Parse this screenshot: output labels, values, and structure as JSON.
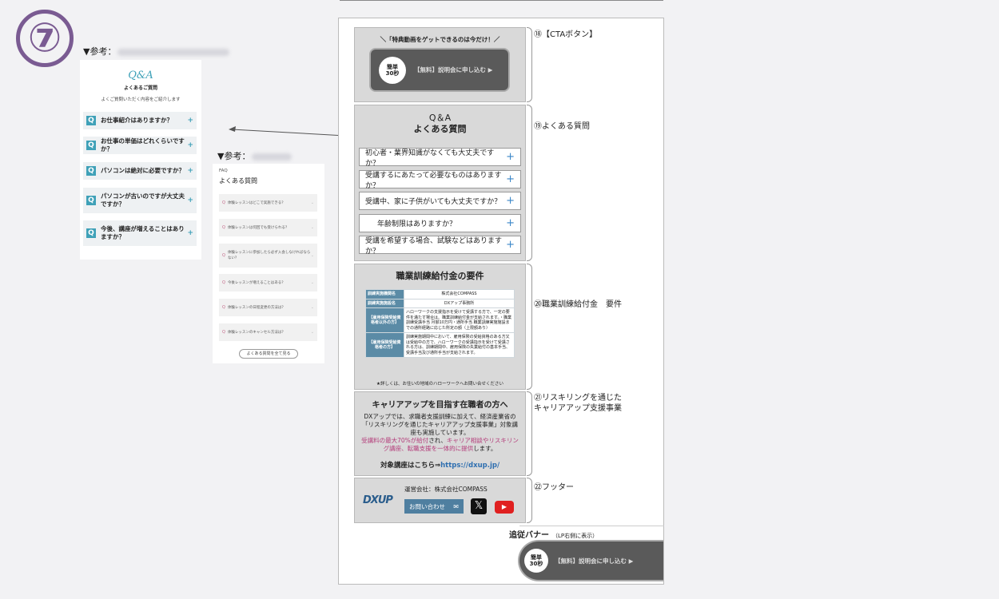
{
  "step_number": "⑦",
  "ref1": {
    "label": "▼参考：",
    "script_title": "Q&A",
    "title": "よくあるご質問",
    "subtitle": "よくご質問いただく内容をご紹介します",
    "q_mark": "Q",
    "plus": "+",
    "items": [
      "お仕事紹介はありますか？",
      "お仕事の単価はどれくらいですか？",
      "パソコンは絶対に必要ですか？",
      "パソコンが古いのですが大丈夫ですか？",
      "今後、講座が増えることはありますか？"
    ]
  },
  "ref2": {
    "label": "▼参考：",
    "eyebrow": "FAQ",
    "title": "よくある質問",
    "q_mark": "Q",
    "chevron": "⌄",
    "items": [
      "体験レッスンはどこで実施できる？",
      "体験レッスンは何回でも受けられる？",
      "体験レッスンに参加したら必ず入会しなければならない？",
      "今後レッスンが増えることはある？",
      "体験レッスンの日程変更の方法は？",
      "体験レッスンのキャンセル方法は？"
    ],
    "view_all": "よくある質問を全て見る"
  },
  "cta": {
    "headline": "＼「特典動画をゲットできるのは今だけ！／",
    "badge_line1": "簡単",
    "badge_line2": "30秒",
    "button_label": "【無料】説明会に申し込む ▶"
  },
  "faq": {
    "eyebrow": "Q＆A",
    "title": "よくある質問",
    "plus": "+",
    "items": [
      "初心者・業界知識がなくても大丈夫ですか？",
      "受講するにあたって必要なものはありますか？",
      "受講中、家に子供がいても大丈夫ですか？",
      "年齢制限はありますか？",
      "受講を希望する場合、試験などはありますか？"
    ]
  },
  "requirements": {
    "title": "職業訓練給付金の要件",
    "rows": [
      {
        "head": "訓練実施機関名",
        "value": "株式会社COMPASS"
      },
      {
        "head": "訓練実施施設名",
        "value": "DXアップ事務所"
      },
      {
        "head": "【雇用保険受給資格者以外の方】",
        "value": "ハローワークの支援指示を受けて受講する方で、一定の要件を満たす場合は、職業訓練給付金が支給されます。・職業訓練受講手当 月額10万円・通所手当 職業訓練実施施設までの通所経路に応じた所定の額（上限額あり）"
      },
      {
        "head": "【雇用保険受給資格者の方】",
        "value": "訓練実施期間中において、雇用保険の受給資格のある方又は受給中の方で、ハローワークの受講指示を受けて受講される方は、訓練期間中、雇用保険の失業給付の基本手当、受講手当及び通所手当が支給されます。"
      }
    ],
    "footnote": "★詳しくは、お住いの地域のハローワークへお問い合せください"
  },
  "career": {
    "title": "キャリアアップを目指す在職者の方へ",
    "body": "DXアップでは、求職者支援訓練に加えて、経済産業省の「リスキリングを通じたキャリアアップ支援事業」対象講座も実施しています。",
    "highlight_1": "受講料の最大70%が給付",
    "highlight_mid": "され、",
    "highlight_2": "キャリア相談やリスキリング講座、転職支援を一体的に提供",
    "highlight_end": "します。",
    "link_label": "対象講座はこちら⇒",
    "link_url": "https://dxup.jp/"
  },
  "footer": {
    "operator": "運営会社：株式会社COMPASS",
    "logo_text": "DXUP",
    "contact_label": "お問い合わせ",
    "x_glyph": "𝕏",
    "yt_glyph": "▶"
  },
  "notes": {
    "n18": "⑱【CTAボタン】",
    "n19": "⑲よくある質問",
    "n20": "⑳職業訓練給付金　要件",
    "n21_line1": "㉑リスキリングを通じた",
    "n21_line2": "キャリアアップ支援事業",
    "n22": "㉒フッター"
  },
  "follow_banner": {
    "label": "追従バナー",
    "note": "（LP右側に表示）",
    "badge_line1": "簡単",
    "badge_line2": "30秒",
    "button_label": "【無料】説明会に申し込む ▶"
  },
  "colors": {
    "accent_teal": "#3fa1b8",
    "badge_purple": "#7a5b92",
    "highlight_magenta": "#b43c7a",
    "link_blue": "#2f6fb0",
    "youtube_red": "#e02020"
  }
}
